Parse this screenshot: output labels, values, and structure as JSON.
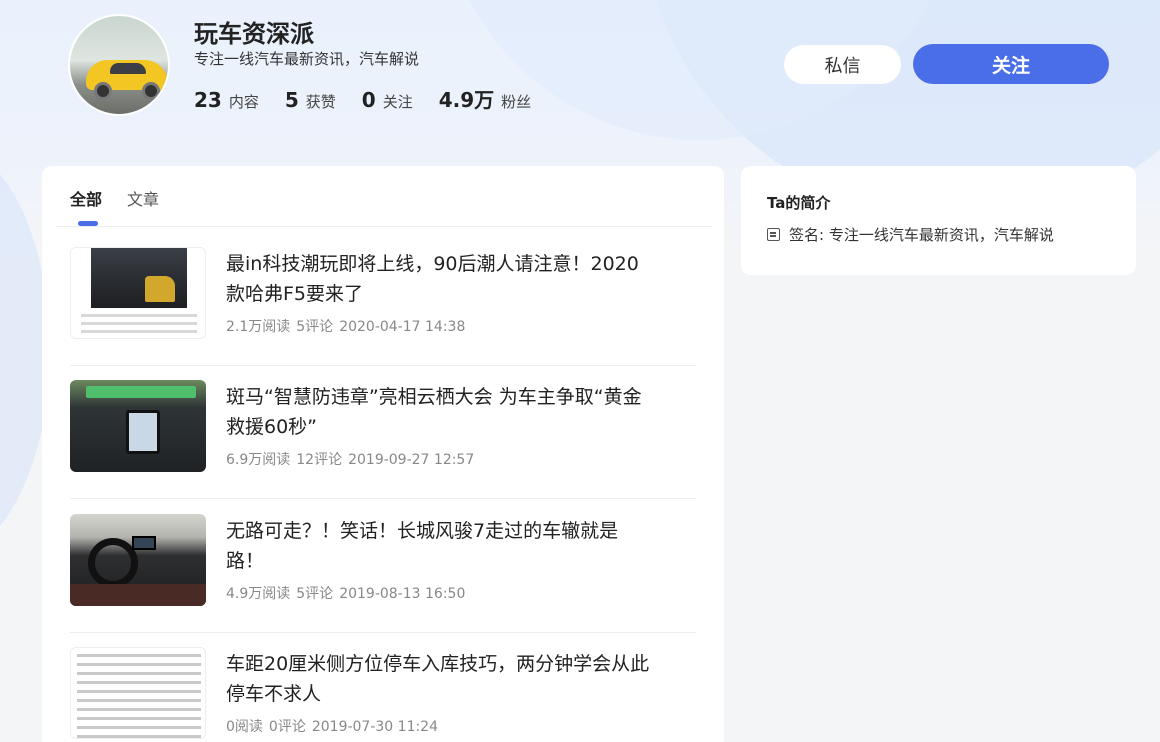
{
  "profile": {
    "name": "玩车资深派",
    "bio": "专注一线汽车最新资讯，汽车解说",
    "stats": [
      {
        "num": "23",
        "label": "内容"
      },
      {
        "num": "5",
        "label": "获赞"
      },
      {
        "num": "0",
        "label": "关注"
      },
      {
        "num": "4.9万",
        "label": "粉丝"
      }
    ],
    "message_label": "私信",
    "follow_label": "关注"
  },
  "tabs": [
    {
      "label": "全部",
      "active": true
    },
    {
      "label": "文章",
      "active": false
    }
  ],
  "articles": [
    {
      "title": "最in科技潮玩即将上线，90后潮人请注意！2020款哈弗F5要来了",
      "reads": "2.1万阅读",
      "comments": "5评论",
      "date": "2020-04-17 14:38"
    },
    {
      "title": "斑马“智慧防违章”亮相云栖大会 为车主争取“黄金救援60秒”",
      "reads": "6.9万阅读",
      "comments": "12评论",
      "date": "2019-09-27 12:57"
    },
    {
      "title": "无路可走？！笑话！长城风骏7走过的车辙就是路！",
      "reads": "4.9万阅读",
      "comments": "5评论",
      "date": "2019-08-13 16:50"
    },
    {
      "title": "车距20厘米侧方位停车入库技巧，两分钟学会从此停车不求人",
      "reads": "0阅读",
      "comments": "0评论",
      "date": "2019-07-30 11:24"
    }
  ],
  "side": {
    "title": "Ta的简介",
    "sign_label": "签名: 专注一线汽车最新资讯，汽车解说",
    "icon": "document-icon"
  },
  "colors": {
    "accent": "#4a6ee8"
  }
}
